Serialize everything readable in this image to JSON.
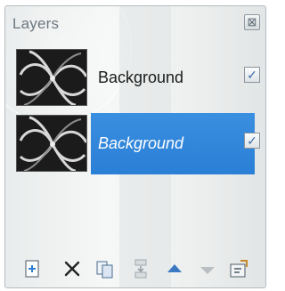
{
  "panel": {
    "title": "Layers",
    "close_glyph": "⊠"
  },
  "layers": [
    {
      "name": "Background",
      "visible_glyph": "✓",
      "selected": false
    },
    {
      "name": "Background",
      "visible_glyph": "✓",
      "selected": true
    }
  ],
  "toolbar": {
    "new_layer_icon": "new-layer-icon",
    "delete_icon": "delete-icon",
    "duplicate_icon": "duplicate-icon",
    "merge_down_icon": "merge-down-icon",
    "move_up_icon": "move-up-icon",
    "move_down_icon": "move-down-icon",
    "properties_icon": "properties-icon"
  },
  "colors": {
    "selection": "#2a7fd6",
    "title_text": "#6d7880"
  }
}
